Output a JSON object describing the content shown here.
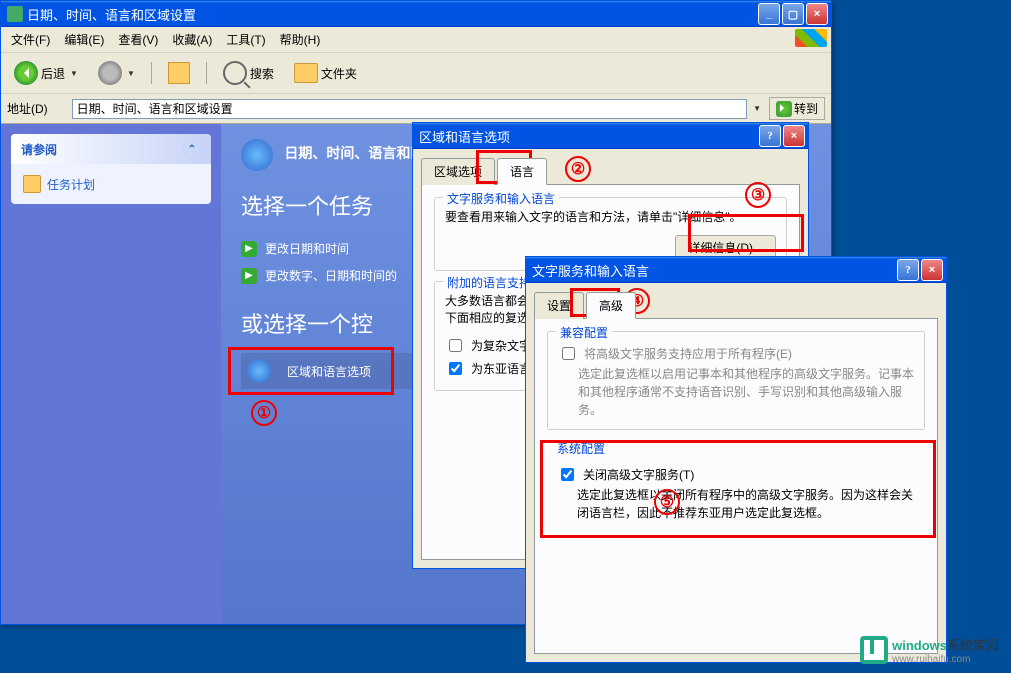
{
  "explorer": {
    "title": "日期、时间、语言和区域设置",
    "menu": {
      "file": "文件(F)",
      "edit": "编辑(E)",
      "view": "查看(V)",
      "fav": "收藏(A)",
      "tools": "工具(T)",
      "help": "帮助(H)"
    },
    "toolbar": {
      "back": "后退",
      "search": "搜索",
      "folders": "文件夹"
    },
    "address_label": "地址(D)",
    "address": "日期、时间、语言和区域设置",
    "go": "转到",
    "sidebox": {
      "title": "请参阅",
      "item1": "任务计划"
    },
    "task": {
      "header": "日期、时间、语言和区",
      "h1": "选择一个任务",
      "link1": "更改日期和时间",
      "link2": "更改数字、日期和时间的",
      "h2": "或选择一个控",
      "link3": "区域和语言选项"
    }
  },
  "dialog1": {
    "title": "区域和语言选项",
    "tab1": "区域选项",
    "tab2": "语言",
    "group1": "文字服务和输入语言",
    "group1_text": "要查看用来输入文字的语言和方法，请单击\"详细信息\"。",
    "details_btn": "详细信息(D)...",
    "group2": "附加的语言支持",
    "group2_text1": "大多数语言都会在",
    "group2_text2": "下面相应的复选框",
    "chk1": "为复杂文字和",
    "chk2": "为东亚语言安"
  },
  "dialog2": {
    "title": "文字服务和输入语言",
    "tab1": "设置",
    "tab2": "高级",
    "group1": "兼容配置",
    "chk1": "将高级文字服务支持应用于所有程序(E)",
    "chk1_desc": "选定此复选框以启用记事本和其他程序的高级文字服务。记事本和其他程序通常不支持语音识别、手写识别和其他高级输入服务。",
    "group2": "系统配置",
    "chk2": "关闭高级文字服务(T)",
    "chk2_desc": "选定此复选框以关闭所有程序中的高级文字服务。因为这样会关闭语言栏，因此不推荐东亚用户选定此复选框。"
  },
  "marks": {
    "m1": "①",
    "m2": "②",
    "m3": "③",
    "m4": "④",
    "m5": "⑤"
  },
  "watermark": {
    "brand": "windows",
    "suffix": "系统家园",
    "url": "www.ruihaifu.com"
  }
}
